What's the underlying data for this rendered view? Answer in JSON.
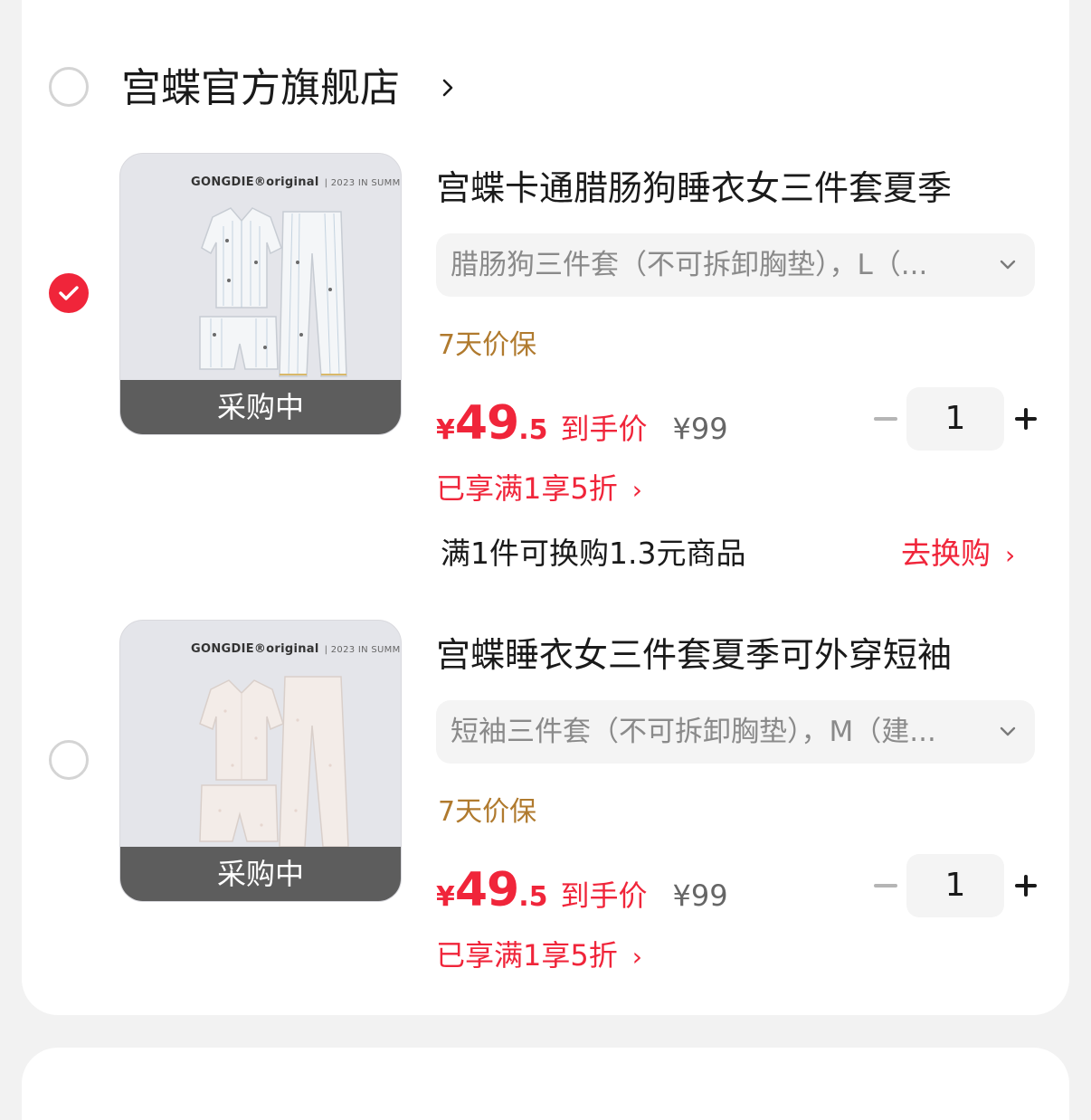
{
  "store": {
    "name": "宫蝶官方旗舰店",
    "selected": false
  },
  "items": [
    {
      "selected": true,
      "thumb_brand": "GONGDIE®original",
      "thumb_overlay": "采购中",
      "title": "宫蝶卡通腊肠狗睡衣女三件套夏季",
      "spec": "腊肠狗三件套（不可拆卸胸垫），L（...",
      "guarantee": "7天价保",
      "price_currency": "¥",
      "price_int": "49",
      "price_dec": ".5",
      "price_tag": "到手价",
      "original_price": "¥99",
      "quantity": "1",
      "promo": "已享满1享5折",
      "exchange_text": "满1件可换购1.3元商品",
      "exchange_link": "去换购"
    },
    {
      "selected": false,
      "thumb_brand": "GONGDIE®original",
      "thumb_overlay": "采购中",
      "title": "宫蝶睡衣女三件套夏季可外穿短袖",
      "spec": "短袖三件套（不可拆卸胸垫），M（建...",
      "guarantee": "7天价保",
      "price_currency": "¥",
      "price_int": "49",
      "price_dec": ".5",
      "price_tag": "到手价",
      "original_price": "¥99",
      "quantity": "1",
      "promo": "已享满1享5折"
    }
  ],
  "colors": {
    "accent": "#f0253a",
    "guarantee": "#b07a2e",
    "background": "#f2f2f2"
  },
  "icons": {
    "chevron_right": "›",
    "chevron_down": "chevron-down-icon"
  }
}
